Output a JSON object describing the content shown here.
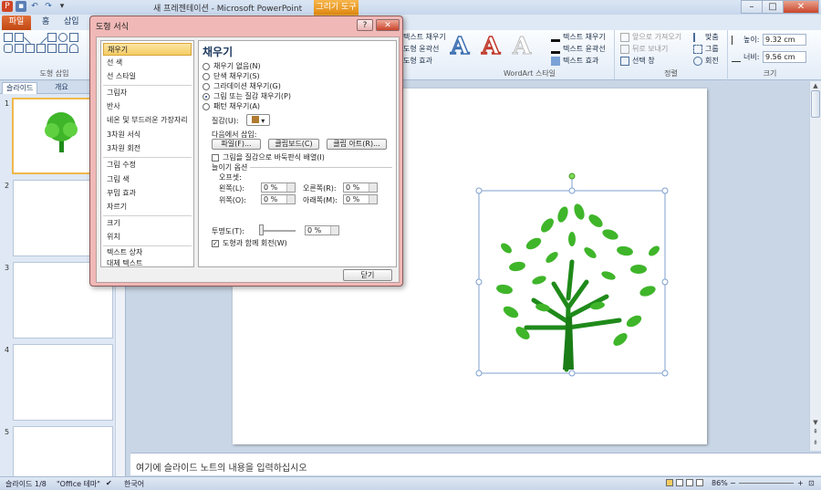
{
  "titlebar": {
    "title": "새 프레젠테이션 - Microsoft PowerPoint",
    "contextual_tab": "그리기 도구",
    "minimize": "–",
    "maximize": "□",
    "close": "✕"
  },
  "tabs": {
    "file": "파일",
    "home": "홈",
    "insert": "삽입"
  },
  "ribbon": {
    "group_insert_shapes": "도형 삽입",
    "shape_fill": "텍스트 채우기",
    "shape_outline": "도형 윤곽선",
    "shape_effects": "도형 효과",
    "text_fill": "텍스트 채우기",
    "text_outline": "텍스트 윤곽선",
    "text_effects": "텍스트 효과",
    "group_wordart": "WordArt 스타일",
    "wordart_letter": "A",
    "bring_forward": "앞으로 가져오기",
    "send_backward": "뒤로 보내기",
    "selection_pane": "선택 창",
    "align": "맞춤",
    "group": "그룹",
    "rotate": "회전",
    "group_arrange": "정렬",
    "height_label": "높이:",
    "height_value": "9.32 cm",
    "width_label": "너비:",
    "width_value": "9.56 cm",
    "group_size": "크기"
  },
  "left_pane": {
    "tab_slides": "슬라이드",
    "tab_outline": "개요",
    "close": "×",
    "slide_numbers": [
      "1",
      "2",
      "3",
      "4",
      "5"
    ]
  },
  "dialog": {
    "title": "도형 서식",
    "help": "?",
    "close_x": "✕",
    "nav": [
      "채우기",
      "선 색",
      "선 스타일",
      "그림자",
      "반사",
      "네온 및 부드러운 가장자리",
      "3차원 서식",
      "3차원 회전",
      "그림 수정",
      "그림 색",
      "꾸밈 효과",
      "자르기",
      "크기",
      "위치",
      "텍스트 상자",
      "대체 텍스트"
    ],
    "section_title": "채우기",
    "fill_options": [
      "채우기 없음(N)",
      "단색 채우기(S)",
      "그라데이션 채우기(G)",
      "그림 또는 질감 채우기(P)",
      "패턴 채우기(A)"
    ],
    "selected_fill_index": 3,
    "texture_label": "질감(U):",
    "insert_from": "다음에서 삽입:",
    "btn_file": "파일(F)...",
    "btn_clipboard": "클립보드(C)",
    "btn_clipart": "클립 아트(R)...",
    "tile_checkbox": "그림을 질감으로 바둑판식 배열(I)",
    "stretch_options": "늘이기 옵션",
    "offsets": "오프셋:",
    "left_label": "왼쪽(L):",
    "left_value": "0 %",
    "right_label": "오른쪽(R):",
    "right_value": "0 %",
    "top_label": "위쪽(O):",
    "top_value": "0 %",
    "bottom_label": "아래쪽(M):",
    "bottom_value": "0 %",
    "transparency_label": "투명도(T):",
    "transparency_value": "0 %",
    "rotate_checkbox": "도형과 함께 회전(W)",
    "rotate_checked": "✓",
    "close_button": "닫기"
  },
  "notes": {
    "placeholder": "여기에 슬라이드 노트의 내용을 입력하십시오"
  },
  "statusbar": {
    "slide_info": "슬라이드 1/8",
    "theme": "\"Office 테마\"",
    "language": "한국어",
    "zoom": "86%",
    "minus": "−",
    "plus": "+"
  },
  "colors": {
    "accent_file_tab": "#c24812",
    "contextual_tab": "#e08a12",
    "dialog_frame": "#f0b8b6",
    "selected_nav": "#f5cc62",
    "tree_green": "#3fb52a"
  }
}
